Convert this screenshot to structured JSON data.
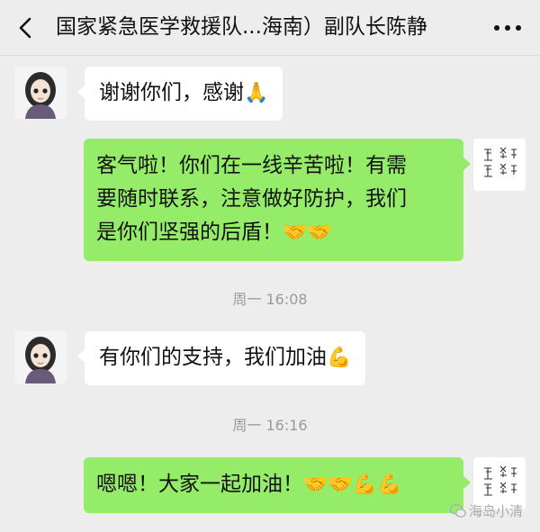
{
  "header": {
    "title": "国家紧急医学救援队...海南）副队长陈静",
    "back_icon": "chevron-left-icon",
    "more_icon": "more-dots-icon"
  },
  "messages": [
    {
      "side": "in",
      "text": "谢谢你们，感谢",
      "emoji": "🙏"
    },
    {
      "side": "out",
      "lines": [
        "客气啦！你们在一线辛苦啦！有需",
        "要随时联系，注意做好防护，我们",
        "是你们坚强的后盾！"
      ],
      "emoji": "🤝🤝"
    },
    {
      "side": "in",
      "text": "有你们的支持，我们加油",
      "emoji": "💪"
    },
    {
      "side": "out",
      "text": "嗯嗯！大家一起加油！",
      "emoji": "🤝🤝💪💪"
    }
  ],
  "timestamps": [
    "周一 16:08",
    "周一 16:16"
  ],
  "watermark": "海岛小清",
  "colors": {
    "background": "#ededed",
    "bubble_out": "#95ec69",
    "bubble_in": "#ffffff",
    "time_text": "#9a9a9a"
  }
}
